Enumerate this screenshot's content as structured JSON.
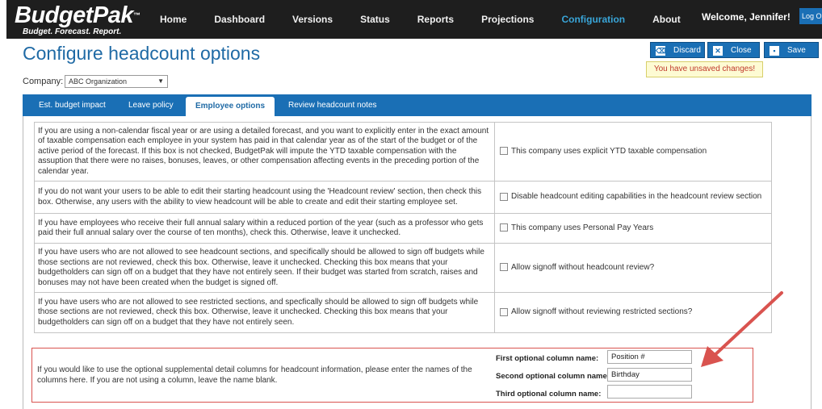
{
  "app": {
    "logo_name": "BudgetPak",
    "logo_tm": "™",
    "tagline": "Budget. Forecast. Report."
  },
  "nav": {
    "items": [
      {
        "label": "Home",
        "active": false
      },
      {
        "label": "Dashboard",
        "active": false
      },
      {
        "label": "Versions",
        "active": false
      },
      {
        "label": "Status",
        "active": false
      },
      {
        "label": "Reports",
        "active": false
      },
      {
        "label": "Projections",
        "active": false
      },
      {
        "label": "Configuration",
        "active": true
      },
      {
        "label": "About",
        "active": false
      }
    ],
    "welcome": "Welcome, Jennifer!",
    "logout": "Log Out"
  },
  "page": {
    "title": "Configure headcount options",
    "company_label": "Company:",
    "company_value": "ABC Organization"
  },
  "actions": {
    "discard": "Discard",
    "close": "Close",
    "save": "Save",
    "unsaved": "You have unsaved changes!"
  },
  "tabs": [
    {
      "label": "Est. budget impact"
    },
    {
      "label": "Leave policy"
    },
    {
      "label": "Employee options"
    },
    {
      "label": "Review headcount notes"
    }
  ],
  "options": [
    {
      "description": "If you are using a non-calendar fiscal year or are using a detailed forecast, and you want to explicitly enter in the exact amount of taxable compensation each employee in your system has paid in that calendar year as of the start of the budget or of the active period of the forecast. If this box is not checked, BudgetPak will impute the YTD taxable compensation with the assuption that there were no raises, bonuses, leaves, or other compensation affecting events in the preceding portion of the calendar year.",
      "control": "This company uses explicit YTD taxable compensation"
    },
    {
      "description": "If you do not want your users to be able to edit their starting headcount using the 'Headcount review' section, then check this box. Otherwise, any users with the ability to view headcount will be able to create and edit their starting employee set.",
      "control": "Disable headcount editing capabilities in the headcount review section"
    },
    {
      "description": "If you have employees who receive their full annual salary within a reduced portion of the year (such as a professor who gets paid their full annual salary over the course of ten months), check this. Otherwise, leave it unchecked.",
      "control": "This company uses Personal Pay Years"
    },
    {
      "description": "If you have users who are not allowed to see headcount sections, and specifically should be allowed to sign off budgets while those sections are not reviewed, check this box. Otherwise, leave it unchecked. Checking this box means that your budgetholders can sign off on a budget that they have not entirely seen. If their budget was started from scratch, raises and bonuses may not have been created when the budget is signed off.",
      "control": "Allow signoff without headcount review?"
    },
    {
      "description": "If you have users who are not allowed to see restricted sections, and specfically should be allowed to sign off budgets while those sections are not reviewed, check this box. Otherwise, leave it unchecked. Checking this box means that your budgetholders can sign off on a budget that they have not entirely seen.",
      "control": "Allow signoff without reviewing restricted sections?"
    }
  ],
  "supplemental": {
    "description": "If you would like to use the optional supplemental detail columns for headcount information, please enter the names of the columns here. If you are not using a column, leave the name blank.",
    "fields": [
      {
        "label": "First optional column name:",
        "value": "Position #"
      },
      {
        "label": "Second optional column name:",
        "value": "Birthday"
      },
      {
        "label": "Third optional column name:",
        "value": ""
      }
    ]
  },
  "colors": {
    "brand_blue": "#1a6fb5",
    "nav_active": "#39a5d8",
    "highlight_red": "#d9534f"
  }
}
